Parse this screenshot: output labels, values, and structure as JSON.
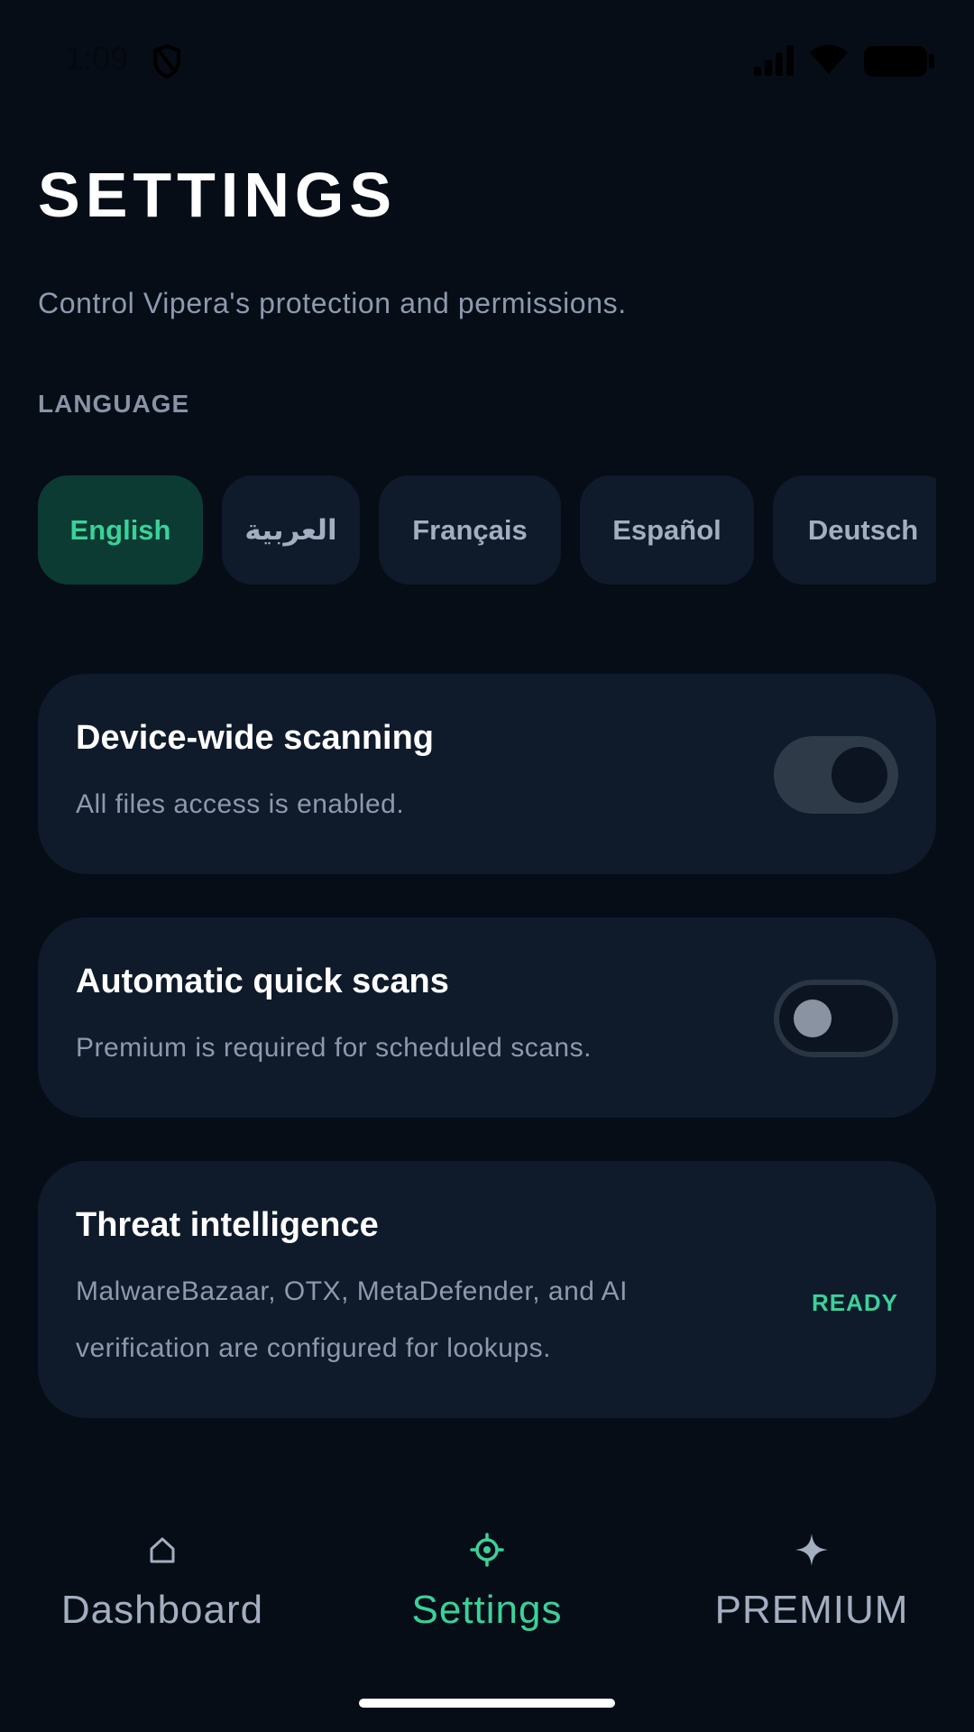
{
  "status_bar": {
    "time": "1:09",
    "icons": [
      "shield-icon",
      "signal-icon",
      "wifi-icon",
      "battery-icon"
    ]
  },
  "header": {
    "title": "SETTINGS",
    "subtitle": "Control Vipera's protection and permissions."
  },
  "language": {
    "label": "LANGUAGE",
    "options": [
      {
        "label": "English",
        "selected": true
      },
      {
        "label": "العربية",
        "selected": false
      },
      {
        "label": "Français",
        "selected": false
      },
      {
        "label": "Español",
        "selected": false
      },
      {
        "label": "Deutsch",
        "selected": false
      }
    ]
  },
  "settings": {
    "device_scanning": {
      "title": "Device-wide scanning",
      "description": "All files access is enabled.",
      "toggle_on": true
    },
    "auto_scans": {
      "title": "Automatic quick scans",
      "description": "Premium is required for scheduled scans.",
      "toggle_on": false
    },
    "threat_intel": {
      "title": "Threat intelligence",
      "description": "MalwareBazaar, OTX, MetaDefender, and AI verification are configured for lookups.",
      "status": "READY"
    }
  },
  "nav": {
    "items": [
      {
        "label": "Dashboard",
        "icon": "home-icon",
        "active": false
      },
      {
        "label": "Settings",
        "icon": "gear-icon",
        "active": true
      },
      {
        "label": "PREMIUM",
        "icon": "sparkle-icon",
        "active": false
      }
    ]
  },
  "colors": {
    "background": "#060d17",
    "card": "#0f1a2b",
    "accent": "#3ad29a",
    "muted_text": "#8d99ad"
  }
}
